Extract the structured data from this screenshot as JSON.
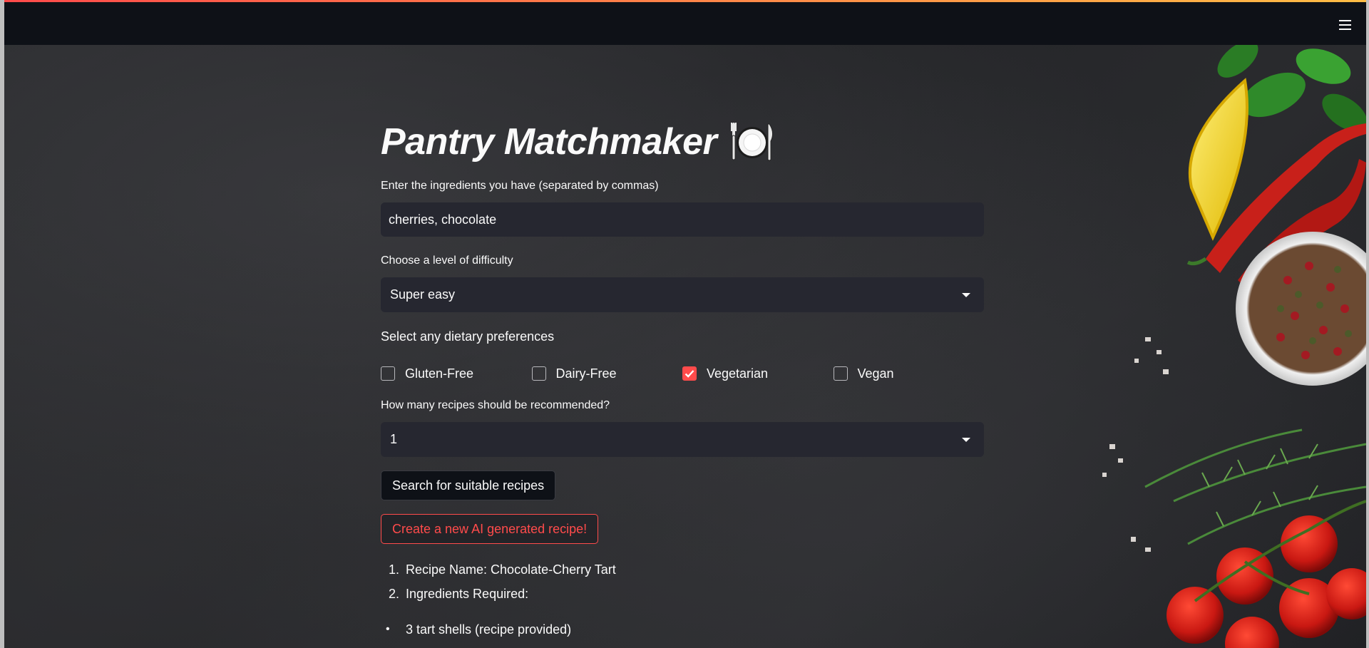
{
  "app": {
    "title": "Pantry Matchmaker",
    "title_icon": "plate-with-cutlery-icon",
    "menu_icon": "hamburger-menu-icon"
  },
  "ingredients": {
    "label": "Enter the ingredients you have (separated by commas)",
    "value": "cherries, chocolate"
  },
  "difficulty": {
    "label": "Choose a level of difficulty",
    "selected": "Super easy"
  },
  "dietary": {
    "label": "Select any dietary preferences",
    "options": [
      {
        "label": "Gluten-Free",
        "checked": false
      },
      {
        "label": "Dairy-Free",
        "checked": false
      },
      {
        "label": "Vegetarian",
        "checked": true
      },
      {
        "label": "Vegan",
        "checked": false
      }
    ]
  },
  "recipe_count": {
    "label": "How many recipes should be recommended?",
    "selected": "1"
  },
  "buttons": {
    "search": "Search for suitable recipes",
    "ai_generate": "Create a new AI generated recipe!"
  },
  "results": {
    "ordered": [
      {
        "num": "1.",
        "text": "Recipe Name: Chocolate-Cherry Tart"
      },
      {
        "num": "2.",
        "text": "Ingredients Required:"
      }
    ],
    "bullets": [
      {
        "bullet": "•",
        "text": "3 tart shells (recipe provided)"
      }
    ]
  },
  "colors": {
    "accent": "#ff4b4b",
    "header_bg": "#0e1117",
    "input_bg": "#262730",
    "text": "#fafafa"
  },
  "background_image": "dark-slate-with-vegetables"
}
